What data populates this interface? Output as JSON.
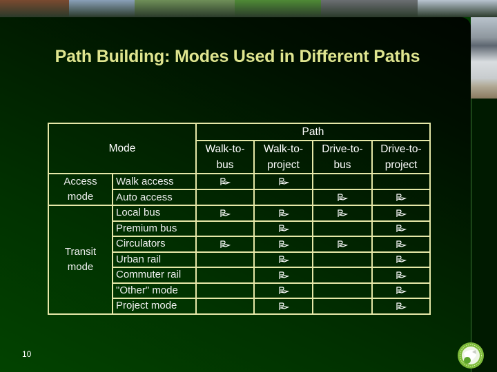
{
  "slide": {
    "title": "Path Building: Modes Used in Different Paths",
    "page_number": "10"
  },
  "photo_strip": [
    {
      "subject": "railcars",
      "color": "#7a4a30"
    },
    {
      "subject": "truck",
      "color": "#8aa0b8"
    },
    {
      "subject": "highway",
      "color": "#6f8f58"
    },
    {
      "subject": "bike-trail",
      "color": "#4f8a36"
    },
    {
      "subject": "transit-station",
      "color": "#6b6e72"
    },
    {
      "subject": "airplane",
      "color": "#b8c4d0"
    }
  ],
  "table": {
    "mode_header": "Mode",
    "path_header": "Path",
    "path_columns": [
      {
        "line1": "Walk-to-",
        "line2": "bus"
      },
      {
        "line1": "Walk-to-",
        "line2": "project"
      },
      {
        "line1": "Drive-to-",
        "line2": "bus"
      },
      {
        "line1": "Drive-to-",
        "line2": "project"
      }
    ],
    "categories": [
      {
        "label_line1": "Access",
        "label_line2": "mode"
      },
      {
        "label_line1": "Transit",
        "label_line2": "mode"
      }
    ],
    "rows": [
      {
        "category": 0,
        "mode": "Walk access",
        "checks": [
          true,
          true,
          false,
          false
        ]
      },
      {
        "category": 0,
        "mode": "Auto access",
        "checks": [
          false,
          false,
          true,
          true
        ]
      },
      {
        "category": 1,
        "mode": "Local bus",
        "checks": [
          true,
          true,
          true,
          true
        ]
      },
      {
        "category": 1,
        "mode": "Premium bus",
        "checks": [
          false,
          true,
          false,
          true
        ]
      },
      {
        "category": 1,
        "mode": "Circulators",
        "checks": [
          true,
          true,
          true,
          true
        ]
      },
      {
        "category": 1,
        "mode": "Urban rail",
        "checks": [
          false,
          true,
          false,
          true
        ]
      },
      {
        "category": 1,
        "mode": "Commuter rail",
        "checks": [
          false,
          true,
          false,
          true
        ]
      },
      {
        "category": 1,
        "mode": "\"Other\" mode",
        "checks": [
          false,
          true,
          false,
          true
        ]
      },
      {
        "category": 1,
        "mode": "Project mode",
        "checks": [
          false,
          true,
          false,
          true
        ]
      }
    ],
    "check_icon": "check-flag-icon"
  },
  "colors": {
    "title": "#dfe58f",
    "grid": "#e6e8a8",
    "background_dark": "#000600",
    "background_green": "#024300"
  }
}
